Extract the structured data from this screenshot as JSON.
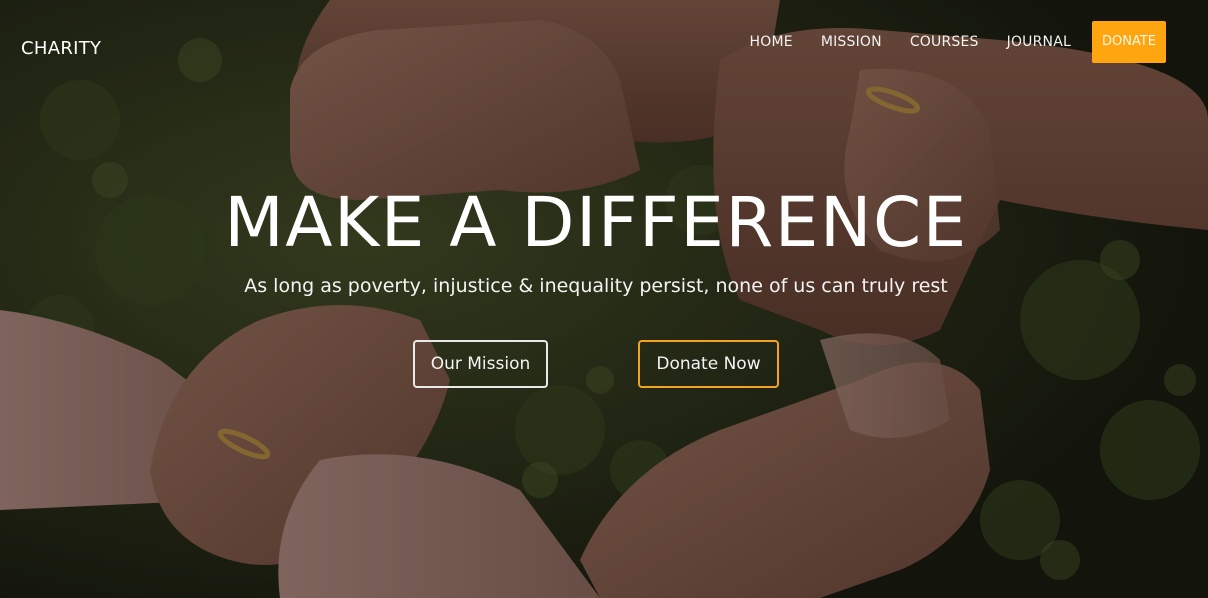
{
  "brand": {
    "logo": "CHARITY"
  },
  "nav": {
    "items": [
      "HOME",
      "MISSION",
      "COURSES",
      "JOURNAL"
    ],
    "donate": "DONATE"
  },
  "hero": {
    "headline": "MAKE A DIFFERENCE",
    "subline": "As long as poverty, injustice & inequality persist, none of us can truly rest",
    "primary_button": "Our Mission",
    "secondary_button": "Donate Now"
  },
  "colors": {
    "accent": "#ffa50f",
    "text": "#ffffff"
  }
}
